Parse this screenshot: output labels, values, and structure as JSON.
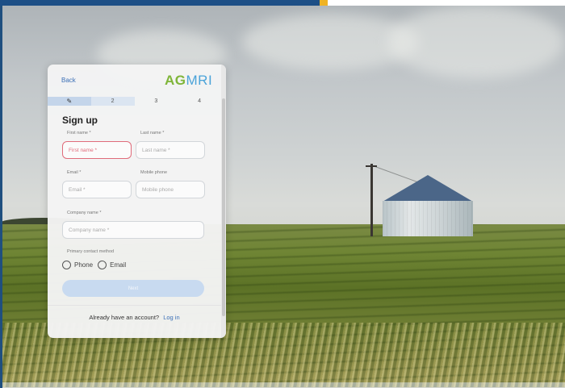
{
  "card": {
    "back_label": "Back",
    "logo": {
      "part1": "AG",
      "part2": "MRI"
    },
    "steps": [
      "",
      "2",
      "3",
      "4"
    ],
    "title": "Sign up",
    "first_name": {
      "label": "First name *",
      "placeholder": "First name *"
    },
    "last_name": {
      "label": "Last name *",
      "placeholder": "Last name *"
    },
    "email": {
      "label": "Email *",
      "placeholder": "Email *"
    },
    "mobile_phone": {
      "label": "Mobile phone",
      "placeholder": "Mobile phone"
    },
    "company_name": {
      "label": "Company name *",
      "placeholder": "Company name *"
    },
    "contact_method": {
      "label": "Primary contact method",
      "options": [
        "Phone",
        "Email"
      ]
    },
    "submit_label": "Next",
    "footer": {
      "text": "Already have an account?",
      "link": "Log in"
    }
  },
  "colors": {
    "accent_blue": "#1d4f86",
    "accent_gold": "#f0b323",
    "link": "#3b6fb6",
    "error": "#e06c7b",
    "logo_green": "#7fb539",
    "logo_blue": "#4ba3d9"
  }
}
